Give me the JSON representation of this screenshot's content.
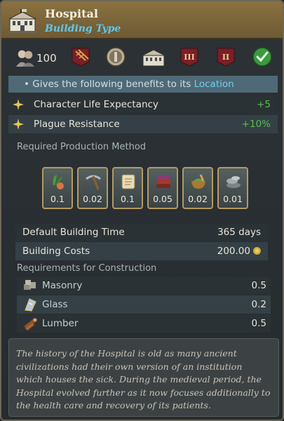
{
  "header": {
    "title": "Hospital",
    "subtitle": "Building Type"
  },
  "badges": {
    "people_count": "100",
    "icons": [
      "people-icon",
      "railway-icon",
      "religion-emblem-icon",
      "building-icon",
      "rank-three-badge-icon",
      "rank-two-badge-icon",
      "checkmark-icon"
    ],
    "rank_three": "III",
    "rank_two": "II"
  },
  "benefits": {
    "intro_prefix": "• Gives the following benefits to its ",
    "intro_link": "Location",
    "items": [
      {
        "label": "Character Life Expectancy",
        "value": "+5"
      },
      {
        "label": "Plague Resistance",
        "value": "+10%"
      }
    ]
  },
  "production": {
    "title": "Required Production Method",
    "items": [
      {
        "icon": "herb-icon",
        "amount": "0.1"
      },
      {
        "icon": "pickaxe-icon",
        "amount": "0.02"
      },
      {
        "icon": "scroll-icon",
        "amount": "0.1"
      },
      {
        "icon": "books-icon",
        "amount": "0.05"
      },
      {
        "icon": "mortar-icon",
        "amount": "0.02"
      },
      {
        "icon": "metal-ingots-icon",
        "amount": "0.01"
      }
    ]
  },
  "building": {
    "time_label": "Default Building Time",
    "time_value": "365 days",
    "cost_label": "Building Costs",
    "cost_value": "200.00"
  },
  "requirements": {
    "title": "Requirements for Construction",
    "items": [
      {
        "icon": "masonry-icon",
        "label": "Masonry",
        "value": "0.5"
      },
      {
        "icon": "glass-icon",
        "label": "Glass",
        "value": "0.2"
      },
      {
        "icon": "lumber-icon",
        "label": "Lumber",
        "value": "0.5"
      }
    ]
  },
  "description": "The history of the Hospital is old as many ancient civilizations had their own version of an institution which houses the sick. During the medieval period, the Hospital evolved further as it now focuses additionally to the health care and recovery of its patients.",
  "colors": {
    "header_gold": "#8a7140",
    "subtitle_blue": "#5fc8ec",
    "positive_green": "#5bbf4a",
    "benefit_bar": "#4f6a76",
    "pm_border": "#b49a62"
  }
}
